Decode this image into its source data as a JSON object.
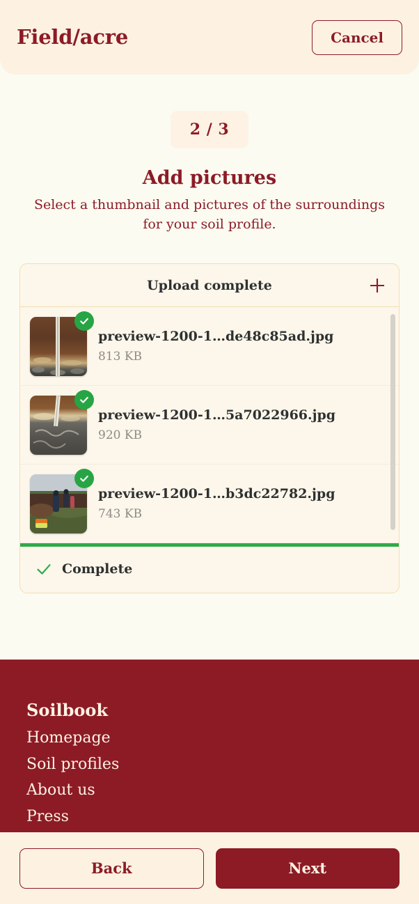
{
  "header": {
    "brand": "Field/acre",
    "cancel_label": "Cancel"
  },
  "wizard": {
    "step_label": "2 / 3",
    "title": "Add pictures",
    "subtitle": "Select a thumbnail and pictures of the surroundings for your soil profile."
  },
  "upload": {
    "card_title": "Upload complete",
    "add_icon": "plus-icon",
    "files": [
      {
        "name": "preview-1200-1…de48c85ad.jpg",
        "size": "813 KB",
        "status_icon": "check-circle-icon",
        "thumbnail": "soil-profile-with-measuring-tape"
      },
      {
        "name": "preview-1200-1…5a7022966.jpg",
        "size": "920 KB",
        "status_icon": "check-circle-icon",
        "thumbnail": "soil-profile-stony-subsoil"
      },
      {
        "name": "preview-1200-1…b3dc22782.jpg",
        "size": "743 KB",
        "status_icon": "check-circle-icon",
        "thumbnail": "field-survey-people"
      }
    ],
    "progress_percent": 100,
    "status_label": "Complete",
    "status_icon": "check-icon"
  },
  "footer": {
    "heading": "Soilbook",
    "links": [
      {
        "label": "Homepage"
      },
      {
        "label": "Soil profiles"
      },
      {
        "label": "About us"
      },
      {
        "label": "Press"
      }
    ]
  },
  "bottom_bar": {
    "back_label": "Back",
    "next_label": "Next"
  },
  "colors": {
    "brand_red": "#8c1b26",
    "cream": "#fdf2e2",
    "page_bg": "#fbfbf1",
    "card_bg": "#fdf6ea",
    "card_border": "#f1dfb1",
    "success_green": "#2faa4a",
    "text_dark": "#2e3131",
    "text_muted": "#8b8b86"
  }
}
